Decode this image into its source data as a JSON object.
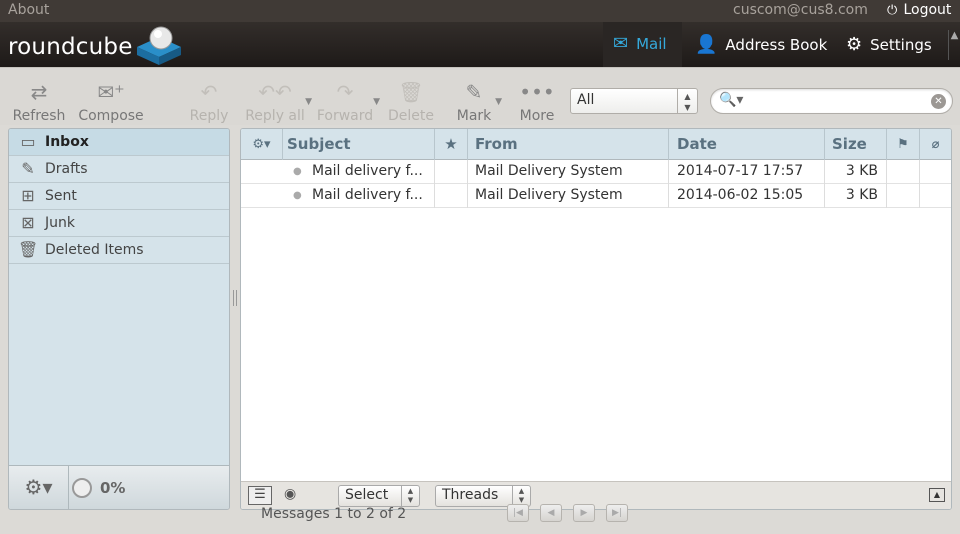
{
  "topline": {
    "about": "About",
    "user": "cuscom@cus8.com",
    "logout": "Logout"
  },
  "header": {
    "logo": "roundcube"
  },
  "nav": [
    {
      "label": "Mail",
      "icon": "envelope-icon",
      "active": true
    },
    {
      "label": "Address Book",
      "icon": "person-icon"
    },
    {
      "label": "Settings",
      "icon": "gear-icon"
    }
  ],
  "toolbar": {
    "refresh": "Refresh",
    "compose": "Compose",
    "reply": "Reply",
    "reply_all": "Reply all",
    "forward": "Forward",
    "delete": "Delete",
    "mark": "Mark",
    "more": "More",
    "filter_value": "All",
    "search_value": ""
  },
  "folders": [
    {
      "label": "Inbox",
      "icon": "inbox-icon",
      "selected": true
    },
    {
      "label": "Drafts",
      "icon": "pencil-icon"
    },
    {
      "label": "Sent",
      "icon": "sent-icon"
    },
    {
      "label": "Junk",
      "icon": "junk-icon"
    },
    {
      "label": "Deleted Items",
      "icon": "trash-icon"
    }
  ],
  "quota": "0%",
  "messages": {
    "headers": {
      "subject": "Subject",
      "from": "From",
      "date": "Date",
      "size": "Size"
    },
    "rows": [
      {
        "subject": "Mail delivery f...",
        "from": "Mail Delivery System",
        "date": "2014-07-17 17:57",
        "size": "3 KB"
      },
      {
        "subject": "Mail delivery f...",
        "from": "Mail Delivery System",
        "date": "2014-06-02 15:05",
        "size": "3 KB"
      }
    ],
    "footer": {
      "select": "Select",
      "threads": "Threads"
    },
    "status": "Messages 1 to 2 of 2"
  },
  "colors": {
    "accent": "#35a9db",
    "header_bg": "#2a2624",
    "pane_bg": "#d5e3ea"
  }
}
